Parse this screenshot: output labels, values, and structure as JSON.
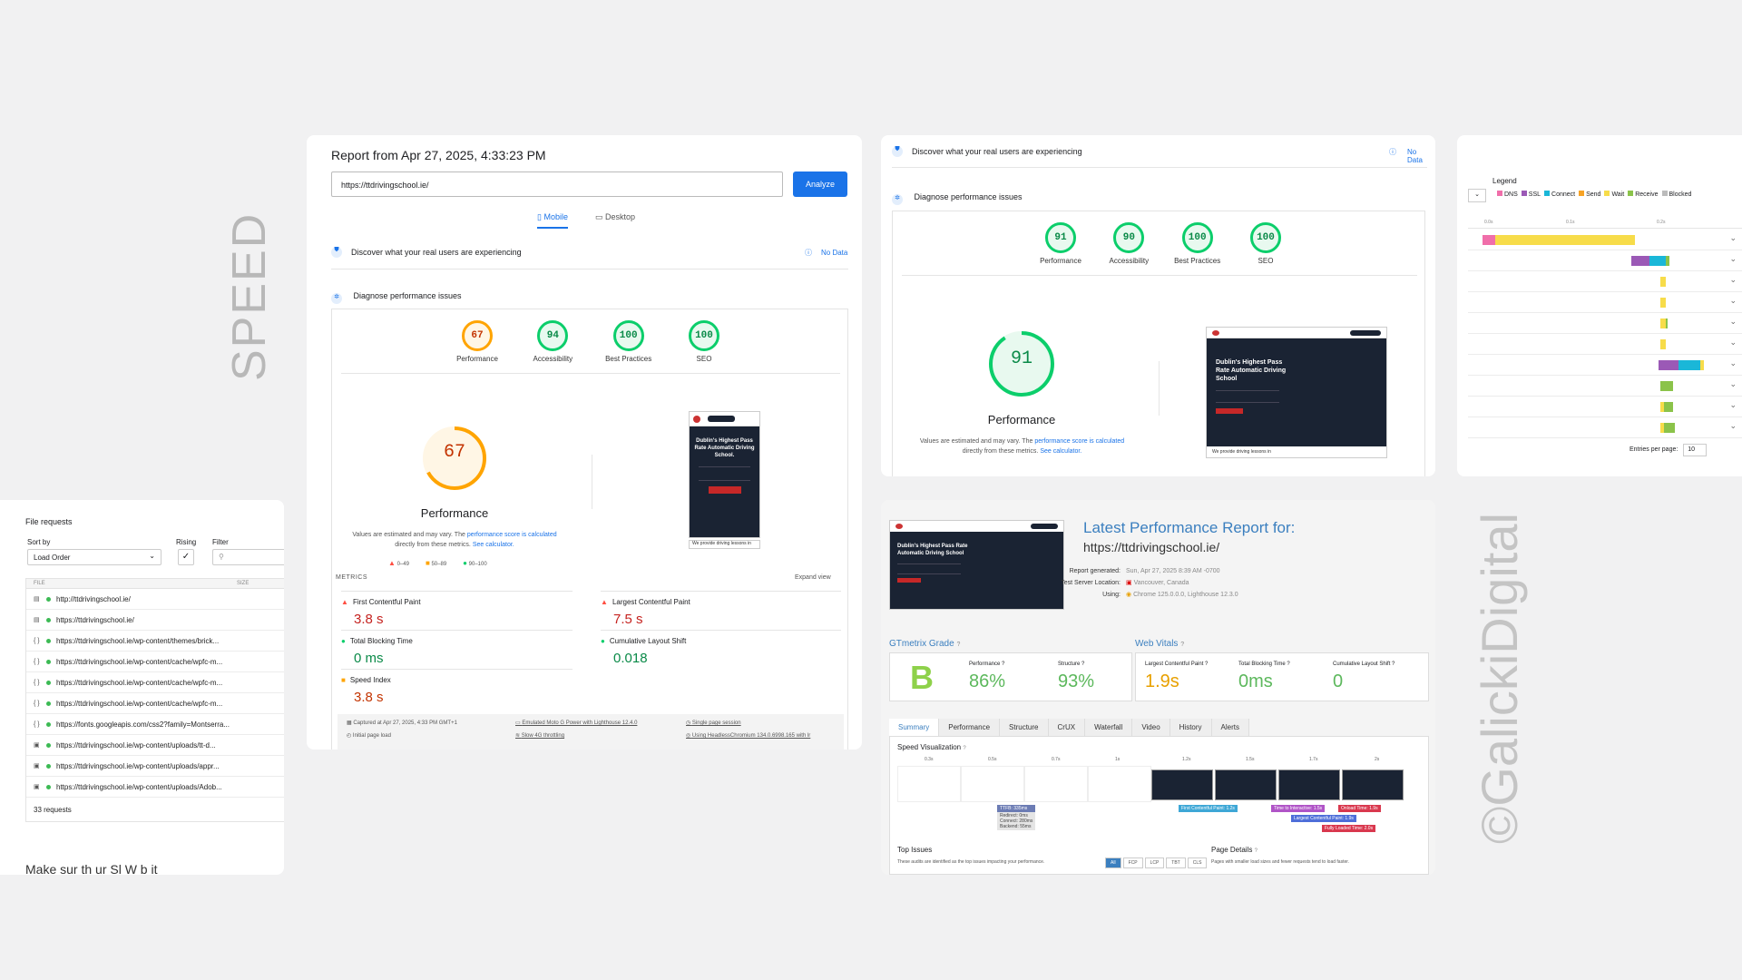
{
  "vertical_labels": {
    "speed": "SPEED",
    "brand": "©GalickiDigital"
  },
  "file_requests": {
    "title": "File requests",
    "sort_by_label": "Sort by",
    "sort_value": "Load Order",
    "rising_label": "Rising",
    "filter_label": "Filter",
    "col_file": "FILE",
    "col_size": "SIZE",
    "files": [
      {
        "icon": "doc-icon",
        "url": "http://ttdrivingschool.ie/"
      },
      {
        "icon": "doc-icon",
        "url": "https://ttdrivingschool.ie/"
      },
      {
        "icon": "code-icon",
        "url": "https://ttdrivingschool.ie/wp-content/themes/brick..."
      },
      {
        "icon": "code-icon",
        "url": "https://ttdrivingschool.ie/wp-content/cache/wpfc-m..."
      },
      {
        "icon": "code-icon",
        "url": "https://ttdrivingschool.ie/wp-content/cache/wpfc-m..."
      },
      {
        "icon": "code-icon",
        "url": "https://ttdrivingschool.ie/wp-content/cache/wpfc-m..."
      },
      {
        "icon": "code-icon",
        "url": "https://fonts.googleapis.com/css2?family=Montserra..."
      },
      {
        "icon": "image-icon",
        "url": "https://ttdrivingschool.ie/wp-content/uploads/tt-d..."
      },
      {
        "icon": "image-icon",
        "url": "https://ttdrivingschool.ie/wp-content/uploads/appr..."
      },
      {
        "icon": "image-icon",
        "url": "https://ttdrivingschool.ie/wp-content/uploads/Adob..."
      }
    ],
    "requests_count": "33 requests",
    "cut_text": "Make sur  th  ur Sl  W b it"
  },
  "psi_mobile": {
    "report_title": "Report from Apr 27, 2025, 4:33:23 PM",
    "url_value": "https://ttdrivingschool.ie/",
    "analyze_label": "Analyze",
    "tab_mobile": "Mobile",
    "tab_desktop": "Desktop",
    "real_users_text": "Discover what your real users are experiencing",
    "no_data": "No Data",
    "diagnose_text": "Diagnose performance issues",
    "scores": [
      {
        "value": "67",
        "label": "Performance",
        "color": "orange"
      },
      {
        "value": "94",
        "label": "Accessibility",
        "color": "green"
      },
      {
        "value": "100",
        "label": "Best Practices",
        "color": "green"
      },
      {
        "value": "100",
        "label": "SEO",
        "color": "green"
      }
    ],
    "big_score": "67",
    "big_label": "Performance",
    "values_note_1": "Values are estimated and may vary. The ",
    "values_note_link": "performance score is calculated",
    "values_note_2": "directly from these metrics. ",
    "calc_link": "See calculator.",
    "legend": [
      {
        "range": "0–49",
        "color": "#ff4e42"
      },
      {
        "range": "50–89",
        "color": "#ffa400"
      },
      {
        "range": "90–100",
        "color": "#0cce6b"
      }
    ],
    "metrics_label": "METRICS",
    "expand_view": "Expand view",
    "metrics": [
      {
        "name": "First Contentful Paint",
        "value": "3.8 s",
        "status": "red"
      },
      {
        "name": "Largest Contentful Paint",
        "value": "7.5 s",
        "status": "red"
      },
      {
        "name": "Total Blocking Time",
        "value": "0 ms",
        "status": "green"
      },
      {
        "name": "Cumulative Layout Shift",
        "value": "0.018",
        "status": "green"
      },
      {
        "name": "Speed Index",
        "value": "3.8 s",
        "status": "orange"
      }
    ],
    "footer": [
      "Captured at Apr 27, 2025, 4:33 PM GMT+1",
      "Emulated Moto G Power with Lighthouse 12.4.0",
      "Single page session",
      "Initial page load",
      "Slow 4G throttling",
      "Using HeadlessChromium 134.0.6998.165 with lr"
    ],
    "phone_headline": "Dublin's Highest Pass Rate Automatic Driving School.",
    "phone_bottom": "We provide driving lessons in"
  },
  "psi_desktop": {
    "real_users_text": "Discover what your real users are experiencing",
    "no_data": "No Data",
    "diagnose_text": "Diagnose performance issues",
    "scores": [
      {
        "value": "91",
        "label": "Performance"
      },
      {
        "value": "90",
        "label": "Accessibility"
      },
      {
        "value": "100",
        "label": "Best Practices"
      },
      {
        "value": "100",
        "label": "SEO"
      }
    ],
    "big_score": "91",
    "big_label": "Performance",
    "values_note_1": "Values are estimated and may vary. The ",
    "values_note_link": "performance score is calculated",
    "values_note_2": "directly from these metrics. ",
    "calc_link": "See calculator.",
    "shot_headline": "Dublin's Highest Pass Rate Automatic Driving School",
    "shot_bottom": "We provide driving lessons in"
  },
  "waterfall": {
    "legend_title": "Legend",
    "legend_items": [
      {
        "label": "DNS",
        "color": "#f06eaa"
      },
      {
        "label": "SSL",
        "color": "#9b59b6"
      },
      {
        "label": "Connect",
        "color": "#1ab7d8"
      },
      {
        "label": "Send",
        "color": "#f7a325"
      },
      {
        "label": "Wait",
        "color": "#f7dc4a"
      },
      {
        "label": "Receive",
        "color": "#8bc34a"
      },
      {
        "label": "Blocked",
        "color": "#bbbbbb"
      }
    ],
    "ticks": [
      "0.0s",
      "0.1s",
      "0.2s"
    ],
    "entries_label": "Entries per page:",
    "entries_value": "10"
  },
  "gtmetrix": {
    "title": "Latest Performance Report for:",
    "url": "https://ttdrivingschool.ie/",
    "report_generated_label": "Report generated:",
    "report_generated": "Sun, Apr 27, 2025 8:39 AM -0700",
    "server_label": "Test Server Location:",
    "server": "Vancouver, Canada",
    "using_label": "Using:",
    "using": "Chrome 125.0.0.0, Lighthouse 12.3.0",
    "grade_title": "GTmetrix Grade",
    "grade": "B",
    "performance_label": "Performance",
    "performance": "86%",
    "structure_label": "Structure",
    "structure": "93%",
    "vitals_title": "Web Vitals",
    "lcp_label": "Largest Contentful Paint",
    "lcp": "1.9s",
    "tbt_label": "Total Blocking Time",
    "tbt": "0ms",
    "cls_label": "Cumulative Layout Shift",
    "cls": "0",
    "tabs": [
      "Summary",
      "Performance",
      "Structure",
      "CrUX",
      "Waterfall",
      "Video",
      "History",
      "Alerts"
    ],
    "speed_viz": "Speed Visualization",
    "viz_ticks": [
      "0.3s",
      "0.5s",
      "0.7s",
      "1s",
      "1.2s",
      "1.5s",
      "1.7s",
      "2s"
    ],
    "markers": [
      "TTFB: 335ms",
      "First Contentful Paint: 1.2s",
      "Time to Interactive: 1.5s",
      "Onload Time: 1.9s",
      "Largest Contentful Paint: 1.9s",
      "Fully Loaded Time: 2.0s"
    ],
    "ttfb_lines": [
      "Redirect: 0ms",
      "Connect: 280ms",
      "Backend: 55ms"
    ],
    "top_issues": "Top Issues",
    "top_issues_desc": "These audits are identified as the top issues impacting your performance.",
    "issue_filters": [
      "All",
      "FCP",
      "LCP",
      "TBT",
      "CLS"
    ],
    "page_details": "Page Details",
    "page_details_desc": "Pages with smaller load sizes and fewer requests tend to load faster.",
    "shot_headline": "Dublin's Highest Pass Rate Automatic Driving School"
  }
}
